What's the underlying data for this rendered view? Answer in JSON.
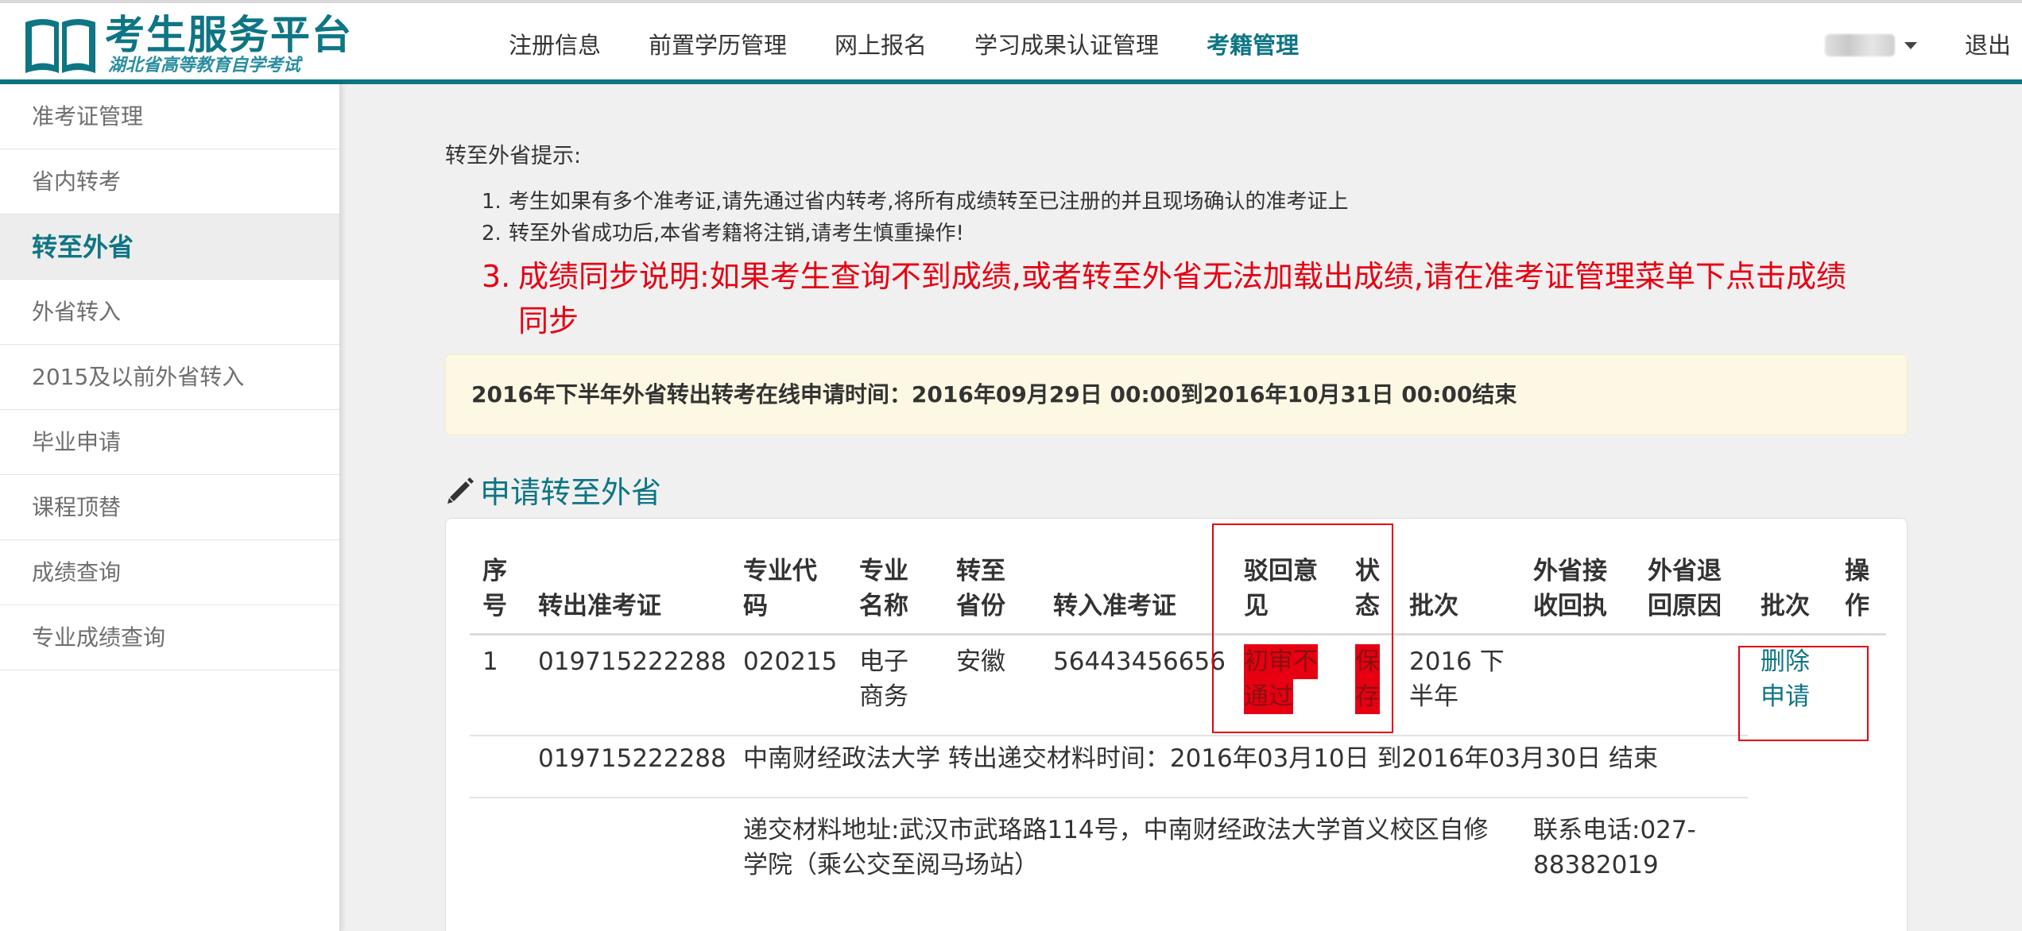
{
  "header": {
    "logo_title": "考生服务平台",
    "logo_subtitle": "湖北省高等教育自学考试",
    "nav": [
      "注册信息",
      "前置学历管理",
      "网上报名",
      "学习成果认证管理",
      "考籍管理"
    ],
    "active_nav": "考籍管理",
    "logout": "退出"
  },
  "sidebar": {
    "items": [
      "准考证管理",
      "省内转考",
      "转至外省",
      "外省转入",
      "2015及以前外省转入",
      "毕业申请",
      "课程顶替",
      "成绩查询",
      "专业成绩查询"
    ],
    "active": "转至外省"
  },
  "hints": {
    "title": "转至外省提示:",
    "items": [
      {
        "num": "1.",
        "text": "考生如果有多个准考证,请先通过省内转考,将所有成绩转至已注册的并且现场确认的准考证上"
      },
      {
        "num": "2.",
        "text": "转至外省成功后,本省考籍将注销,请考生慎重操作!"
      },
      {
        "num": "3.",
        "line1": "成绩同步说明:如果考生查询不到成绩,或者转至外省无法加载出成绩,请在准考证管理菜单下点击成绩",
        "line2": "同步"
      }
    ]
  },
  "notice": "2016年下半年外省转出转考在线申请时间：2016年09月29日 00:00到2016年10月31日 00:00结束",
  "section_title": "申请转至外省",
  "table": {
    "headers": {
      "seq": [
        "序",
        "号"
      ],
      "out_ticket": "转出准考证",
      "major_code": [
        "专业代",
        "码"
      ],
      "major_name": [
        "专业",
        "名称"
      ],
      "to_province": [
        "转至",
        "省份"
      ],
      "in_ticket": "转入准考证",
      "reject_opinion": [
        "驳回意",
        "见"
      ],
      "status": [
        "状",
        "态"
      ],
      "batch": "批次",
      "receipt": [
        "外省接",
        "收回执"
      ],
      "return_reason": [
        "外省退",
        "回原因"
      ],
      "batch2": "批次",
      "operation": [
        "操",
        "作"
      ]
    },
    "row": {
      "seq": "1",
      "out_ticket": "019715222288",
      "major_code": "020215",
      "major_name": [
        "电子",
        "商务"
      ],
      "to_province": "安徽",
      "in_ticket": "56443456656",
      "reject_opinion": [
        "初审不",
        "通过"
      ],
      "status": [
        "保",
        "存"
      ],
      "batch": [
        "2016 下",
        "半年"
      ],
      "operation": [
        "删除",
        "申请"
      ]
    },
    "detail": {
      "ticket": "019715222288",
      "school_time": "中南财经政法大学 转出递交材料时间：2016年03月10日 到2016年03月30日 结束",
      "address": [
        "递交材料地址:武汉市武珞路114号，中南财经政法大学首义校区自修",
        "学院（乘公交至阅马场站）"
      ],
      "phone": [
        "联系电话:027-",
        "88382019"
      ]
    }
  },
  "colors": {
    "teal": "#0e7584",
    "red": "#e60012",
    "notice_bg": "#fcf8e3"
  }
}
